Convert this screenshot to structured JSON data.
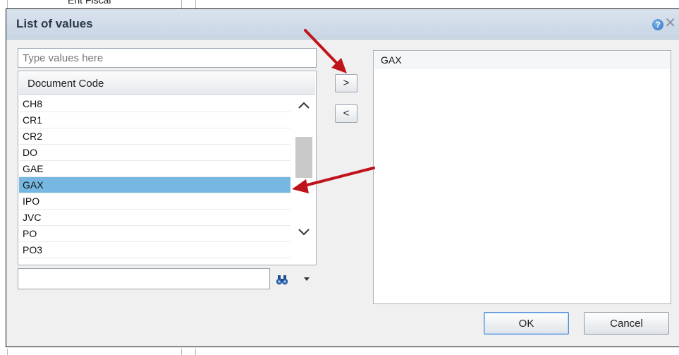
{
  "background": {
    "partial_text": "Ent Fiscal"
  },
  "dialog": {
    "title": "List of values",
    "help_glyph": "?",
    "close_glyph": "✕"
  },
  "search": {
    "placeholder": "Type values here",
    "value": ""
  },
  "available_list": {
    "column_header": "Document Code",
    "items": [
      "CH8",
      "CR1",
      "CR2",
      "DO",
      "GAE",
      "GAX",
      "IPO",
      "JVC",
      "PO",
      "PO3"
    ],
    "selected_item": "GAX"
  },
  "move_buttons": {
    "add": ">",
    "remove": "<"
  },
  "selected_list": {
    "items": [
      "GAX"
    ]
  },
  "find": {
    "value": "",
    "icon": "binoculars-icon"
  },
  "buttons": {
    "ok": "OK",
    "cancel": "Cancel"
  },
  "colors": {
    "selection": "#76b8e2",
    "title_bar": "#d9e3ee",
    "annotation_arrow": "#c0141c"
  }
}
